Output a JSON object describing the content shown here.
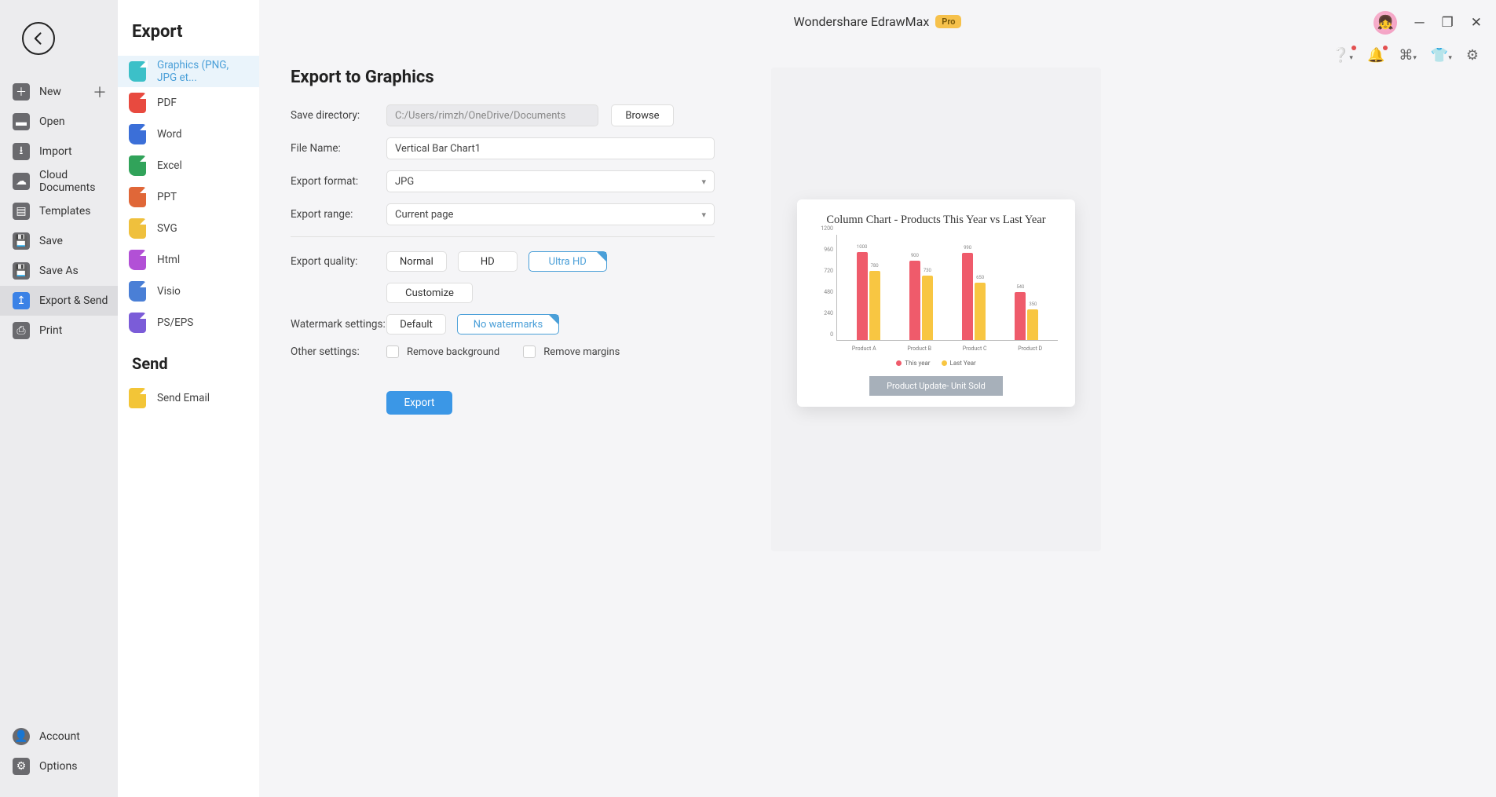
{
  "titlebar": {
    "title": "Wondershare EdrawMax",
    "badge": "Pro"
  },
  "nav": {
    "items": [
      {
        "label": "New",
        "has_plus": true
      },
      {
        "label": "Open"
      },
      {
        "label": "Import"
      },
      {
        "label": "Cloud Documents"
      },
      {
        "label": "Templates"
      },
      {
        "label": "Save"
      },
      {
        "label": "Save As"
      },
      {
        "label": "Export & Send"
      },
      {
        "label": "Print"
      }
    ],
    "bottom": [
      {
        "label": "Account"
      },
      {
        "label": "Options"
      }
    ]
  },
  "export_sidebar": {
    "heading": "Export",
    "send_heading": "Send",
    "formats": [
      {
        "label": "Graphics (PNG, JPG et...",
        "color": "#3cc0c8"
      },
      {
        "label": "PDF",
        "color": "#e84a3f"
      },
      {
        "label": "Word",
        "color": "#3b6fd8"
      },
      {
        "label": "Excel",
        "color": "#31a35a"
      },
      {
        "label": "PPT",
        "color": "#e06738"
      },
      {
        "label": "SVG",
        "color": "#efc03d"
      },
      {
        "label": "Html",
        "color": "#b250d6"
      },
      {
        "label": "Visio",
        "color": "#4a7fd6"
      },
      {
        "label": "PS/EPS",
        "color": "#7b5cd8"
      }
    ],
    "send": [
      {
        "label": "Send Email",
        "color": "#f3c537"
      }
    ]
  },
  "form": {
    "title": "Export to Graphics",
    "labels": {
      "save_dir": "Save directory:",
      "file_name": "File Name:",
      "format": "Export format:",
      "range": "Export range:",
      "quality": "Export quality:",
      "watermark": "Watermark settings:",
      "other": "Other settings:"
    },
    "values": {
      "save_dir": "C:/Users/rimzh/OneDrive/Documents",
      "file_name": "Vertical Bar Chart1",
      "format": "JPG",
      "range": "Current page"
    },
    "buttons": {
      "browse": "Browse",
      "normal": "Normal",
      "hd": "HD",
      "ultra": "Ultra HD",
      "customize": "Customize",
      "default": "Default",
      "no_watermark": "No watermarks",
      "export": "Export"
    },
    "checks": {
      "remove_bg": "Remove background",
      "remove_margins": "Remove margins"
    }
  },
  "preview": {
    "title": "Column Chart - Products This Year vs Last Year",
    "footer": "Product Update- Unit Sold",
    "legend": {
      "a": "This year",
      "b": "Last Year"
    }
  },
  "chart_data": {
    "type": "bar",
    "title": "Column Chart - Products This Year vs Last Year",
    "categories": [
      "Product A",
      "Product B",
      "Product C",
      "Product D"
    ],
    "series": [
      {
        "name": "This year",
        "color": "#ef5b6b",
        "values": [
          1000,
          900,
          990,
          540
        ]
      },
      {
        "name": "Last Year",
        "color": "#f8c642",
        "values": [
          780,
          730,
          650,
          350
        ]
      }
    ],
    "ylim": [
      0,
      1200
    ],
    "y_ticks": [
      0,
      240,
      480,
      720,
      960,
      1200
    ],
    "xlabel": "",
    "ylabel": ""
  }
}
